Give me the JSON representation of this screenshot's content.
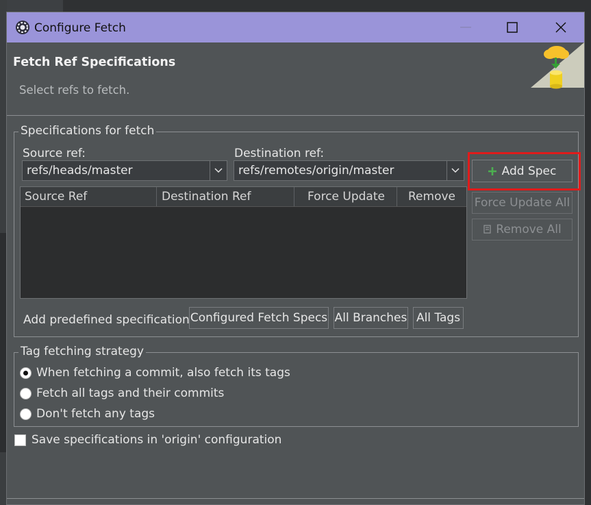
{
  "window": {
    "title": "Configure Fetch",
    "controls": [
      "minimize",
      "maximize",
      "close"
    ]
  },
  "header": {
    "title": "Fetch Ref Specifications",
    "subtitle": "Select refs to fetch.",
    "icon": "cloud-download-database-icon"
  },
  "specs_group": {
    "legend": "Specifications for fetch",
    "source_label": "Source ref:",
    "source_value": "refs/heads/master",
    "dest_label": "Destination ref:",
    "dest_value": "refs/remotes/origin/master",
    "table_columns": [
      "Source Ref",
      "Destination Ref",
      "Force Update",
      "Remove"
    ],
    "table_rows": [],
    "add_spec_label": "Add Spec",
    "force_update_all_label": "Force Update All",
    "remove_all_label": "Remove All",
    "predefined_label": "Add predefined specification",
    "configured_fetch_specs_label": "Configured Fetch Specs",
    "all_branches_label": "All Branches",
    "all_tags_label": "All Tags"
  },
  "tag_group": {
    "legend": "Tag fetching strategy",
    "options": [
      {
        "label": "When fetching a commit, also fetch its tags",
        "selected": true
      },
      {
        "label": "Fetch all tags and their commits",
        "selected": false
      },
      {
        "label": "Don't fetch any tags",
        "selected": false
      }
    ]
  },
  "save_config": {
    "label": "Save specifications in 'origin' configuration",
    "checked": false
  },
  "colors": {
    "titlebar": "#9a94d9",
    "dialog_bg": "#505456",
    "highlight": "#e01b1b",
    "add_icon": "#4caf50"
  }
}
